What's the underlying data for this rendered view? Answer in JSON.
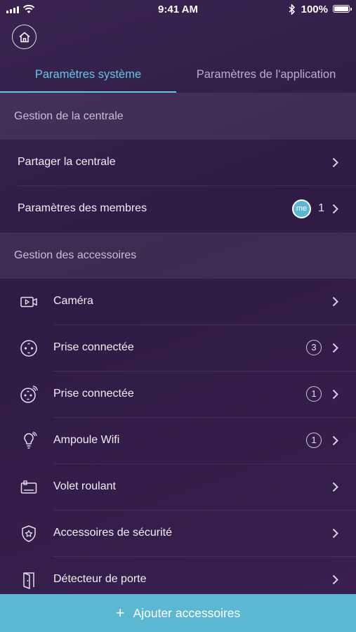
{
  "status_bar": {
    "time": "9:41 AM",
    "battery": "100%"
  },
  "tabs": [
    {
      "label": "Paramètres système",
      "active": true
    },
    {
      "label": "Paramètres de l'application",
      "active": false
    }
  ],
  "sections": {
    "hub": {
      "title": "Gestion de la centrale",
      "items": [
        {
          "label": "Partager la centrale"
        },
        {
          "label": "Paramètres des membres",
          "avatar": "me",
          "count": "1"
        }
      ]
    },
    "accessories": {
      "title": "Gestion des accessoires",
      "items": [
        {
          "label": "Caméra",
          "icon": "camera-icon"
        },
        {
          "label": "Prise connectée",
          "icon": "plug-icon",
          "badge": "3"
        },
        {
          "label": "Prise connectée",
          "icon": "wifi-plug-icon",
          "badge": "1"
        },
        {
          "label": "Ampoule Wifi",
          "icon": "bulb-icon",
          "badge": "1"
        },
        {
          "label": "Volet roulant",
          "icon": "shutter-icon"
        },
        {
          "label": "Accessoires de sécurité",
          "icon": "shield-star-icon"
        },
        {
          "label": "Détecteur de porte",
          "icon": "door-icon"
        }
      ]
    }
  },
  "add_button": {
    "label": "Ajouter accessoires",
    "icon": "plus-icon"
  },
  "colors": {
    "accent": "#5ec9e6",
    "add_bar": "#5bb7d2",
    "background": "#2f1b45"
  }
}
